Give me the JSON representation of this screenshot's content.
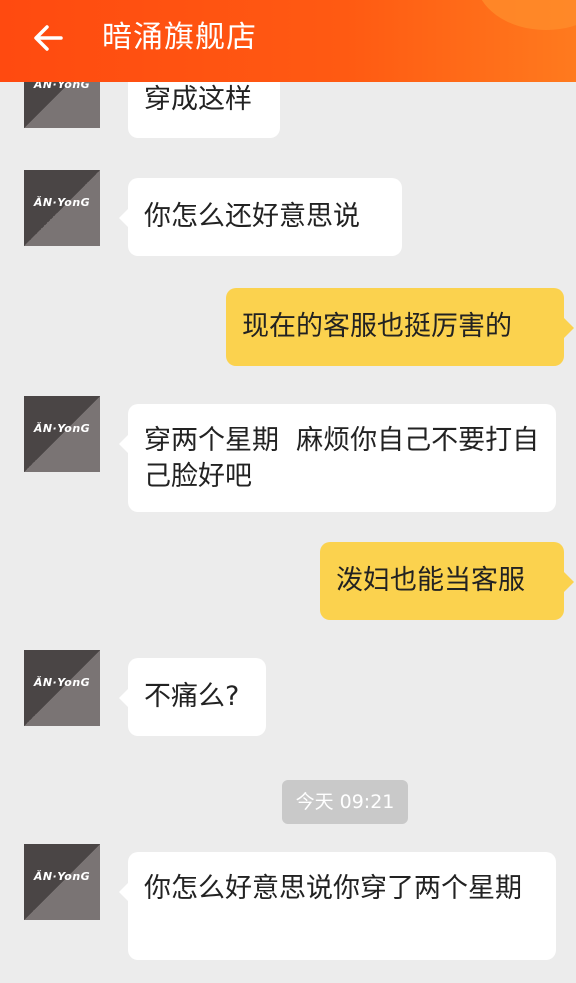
{
  "header": {
    "title": "暗涌旗舰店",
    "back_icon": "arrow-left-icon",
    "color": "#ff5a12"
  },
  "avatar_brand": "ĂN·YonG",
  "messages": [
    {
      "side": "left",
      "text": "穿成这样"
    },
    {
      "side": "left",
      "text": "你怎么还好意思说"
    },
    {
      "side": "right",
      "text": "现在的客服也挺厉害的"
    },
    {
      "side": "left",
      "text": "穿两个星期  麻烦你自己不要打自己脸好吧"
    },
    {
      "side": "right",
      "text": "泼妇也能当客服"
    },
    {
      "side": "left",
      "text": "不痛么?"
    },
    {
      "side": "left",
      "text": "你怎么好意思说你穿了两个星期"
    }
  ],
  "timestamp": "今天 09:21"
}
